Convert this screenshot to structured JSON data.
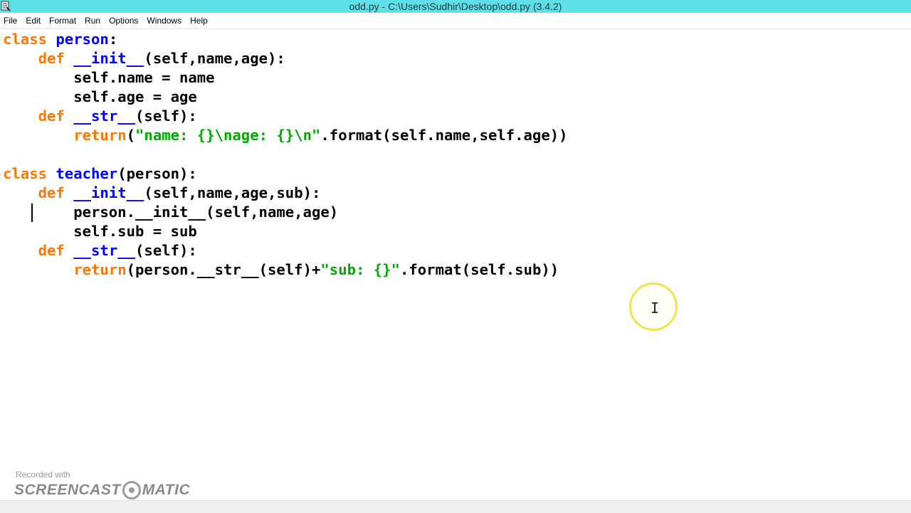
{
  "window": {
    "title": "odd.py - C:\\Users\\Sudhir\\Desktop\\odd.py (3.4.2)"
  },
  "menu": {
    "items": [
      {
        "label": "File"
      },
      {
        "label": "Edit"
      },
      {
        "label": "Format"
      },
      {
        "label": "Run"
      },
      {
        "label": "Options"
      },
      {
        "label": "Windows"
      },
      {
        "label": "Help"
      }
    ]
  },
  "code": {
    "lines": [
      {
        "segments": [
          {
            "t": "class",
            "c": "kw"
          },
          {
            "t": " ",
            "c": ""
          },
          {
            "t": "person",
            "c": "def"
          },
          {
            "t": ":",
            "c": ""
          }
        ]
      },
      {
        "segments": [
          {
            "t": "    ",
            "c": ""
          },
          {
            "t": "def",
            "c": "kw"
          },
          {
            "t": " ",
            "c": ""
          },
          {
            "t": "__init__",
            "c": "def"
          },
          {
            "t": "(self,name,age):",
            "c": ""
          }
        ]
      },
      {
        "segments": [
          {
            "t": "        self.name = name",
            "c": ""
          }
        ]
      },
      {
        "segments": [
          {
            "t": "        self.age = age",
            "c": ""
          }
        ]
      },
      {
        "segments": [
          {
            "t": "    ",
            "c": ""
          },
          {
            "t": "def",
            "c": "kw"
          },
          {
            "t": " ",
            "c": ""
          },
          {
            "t": "__str__",
            "c": "def"
          },
          {
            "t": "(self):",
            "c": ""
          }
        ]
      },
      {
        "segments": [
          {
            "t": "        ",
            "c": ""
          },
          {
            "t": "return",
            "c": "kw"
          },
          {
            "t": "(",
            "c": ""
          },
          {
            "t": "\"name: {}\\nage: {}\\n\"",
            "c": "str"
          },
          {
            "t": ".format(self.name,self.age))",
            "c": ""
          }
        ]
      },
      {
        "segments": []
      },
      {
        "segments": [
          {
            "t": "class",
            "c": "kw"
          },
          {
            "t": " ",
            "c": ""
          },
          {
            "t": "teacher",
            "c": "def"
          },
          {
            "t": "(person):",
            "c": ""
          }
        ]
      },
      {
        "segments": [
          {
            "t": "    ",
            "c": ""
          },
          {
            "t": "def",
            "c": "kw"
          },
          {
            "t": " ",
            "c": ""
          },
          {
            "t": "__init__",
            "c": "def"
          },
          {
            "t": "(self,name,age,sub):",
            "c": ""
          }
        ]
      },
      {
        "segments": [
          {
            "t": "        person.__init__(self,name,age)",
            "c": ""
          }
        ]
      },
      {
        "segments": [
          {
            "t": "        self.sub = sub",
            "c": ""
          }
        ]
      },
      {
        "segments": [
          {
            "t": "    ",
            "c": ""
          },
          {
            "t": "def",
            "c": "kw"
          },
          {
            "t": " ",
            "c": ""
          },
          {
            "t": "__str__",
            "c": "def"
          },
          {
            "t": "(self):",
            "c": ""
          }
        ]
      },
      {
        "segments": [
          {
            "t": "        ",
            "c": ""
          },
          {
            "t": "return",
            "c": "kw"
          },
          {
            "t": "(person.__str__(self)+",
            "c": ""
          },
          {
            "t": "\"sub: {}\"",
            "c": "str"
          },
          {
            "t": ".format(self.sub))",
            "c": ""
          }
        ]
      }
    ]
  },
  "colors": {
    "titlebar": "#5fe0e8",
    "keyword": "#ff7700",
    "definition": "#0000ff",
    "string": "#00aa00"
  },
  "watermark": {
    "small": "Recorded with",
    "brand_left": "SCREENCAST",
    "brand_right": "MATIC"
  }
}
